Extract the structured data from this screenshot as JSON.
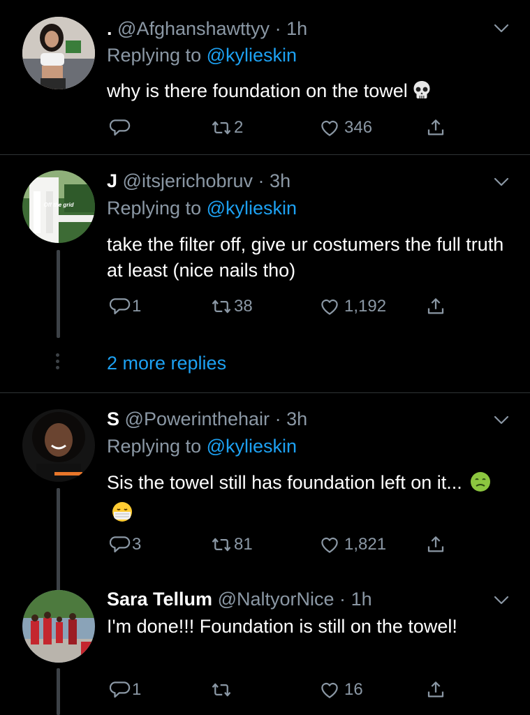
{
  "tweets": [
    {
      "display_name": ".",
      "handle": "@Afghanshawttyy",
      "time": "1h",
      "replying_prefix": "Replying to",
      "replying_to": "@kylieskin",
      "text": "why is there foundation on the towel",
      "emojis": [
        "skull"
      ],
      "replies": "",
      "retweets": "2",
      "likes": "346"
    },
    {
      "display_name": "J",
      "handle": "@itsjerichobruv",
      "time": "3h",
      "replying_prefix": "Replying to",
      "replying_to": "@kylieskin",
      "avatar_text": "Off the grid",
      "text": "take the filter off, give ur costumers the full truth at least (nice nails tho)",
      "replies": "1",
      "retweets": "38",
      "likes": "1,192",
      "more_replies": "2 more replies"
    },
    {
      "display_name": "S",
      "handle": "@Powerinthehair",
      "time": "3h",
      "replying_prefix": "Replying to",
      "replying_to": "@kylieskin",
      "text": "Sis the towel still has foundation left on it...",
      "emojis": [
        "nauseated-face",
        "face-with-medical-mask"
      ],
      "replies": "3",
      "retweets": "81",
      "likes": "1,821"
    },
    {
      "display_name": "Sara Tellum",
      "handle": "@NaltyorNice",
      "time": "1h",
      "text": "I'm done!!! Foundation is still on the towel!",
      "replies": "1",
      "retweets": "",
      "likes": "16"
    }
  ],
  "separator": "·",
  "icons": {
    "reply": "reply-icon",
    "retweet": "retweet-icon",
    "like": "heart-icon",
    "share": "share-icon",
    "caret": "chevron-down-icon"
  },
  "colors": {
    "background": "#000000",
    "text": "#ffffff",
    "muted": "#8b98a5",
    "link": "#1da1f2",
    "divider": "#2f3336"
  }
}
